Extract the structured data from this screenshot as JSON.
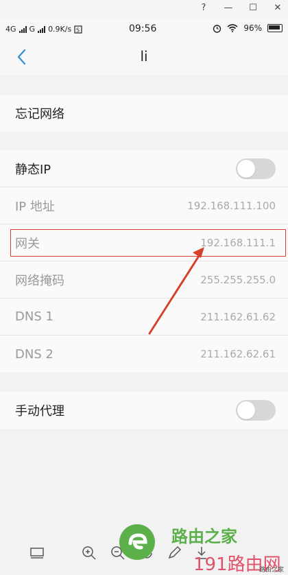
{
  "window": {
    "controls": [
      "?",
      "—",
      "☐",
      "✕"
    ]
  },
  "statusbar": {
    "network1": "4G",
    "network2": "G",
    "speed": "0.9K/s",
    "time": "09:56",
    "battery": "96%"
  },
  "header": {
    "title": "li"
  },
  "rows": {
    "forget": "忘记网络",
    "static_ip": "静态IP",
    "ip_label": "IP 地址",
    "ip_value": "192.168.111.100",
    "gateway_label": "网关",
    "gateway_value": "192.168.111.1",
    "mask_label": "网络掩码",
    "mask_value": "255.255.255.0",
    "dns1_label": "DNS 1",
    "dns1_value": "211.162.61.62",
    "dns2_label": "DNS 2",
    "dns2_value": "211.162.62.61",
    "proxy": "手动代理"
  },
  "toggles": {
    "static_ip_on": false,
    "proxy_on": false
  },
  "watermark": {
    "brand": "路由之家",
    "site": "191路由网",
    "small": "路由之家"
  },
  "colors": {
    "accent": "#2f8fd8",
    "highlight": "#d6412b",
    "brand_green": "#5bb04a",
    "brand_pink": "#e0516a"
  }
}
